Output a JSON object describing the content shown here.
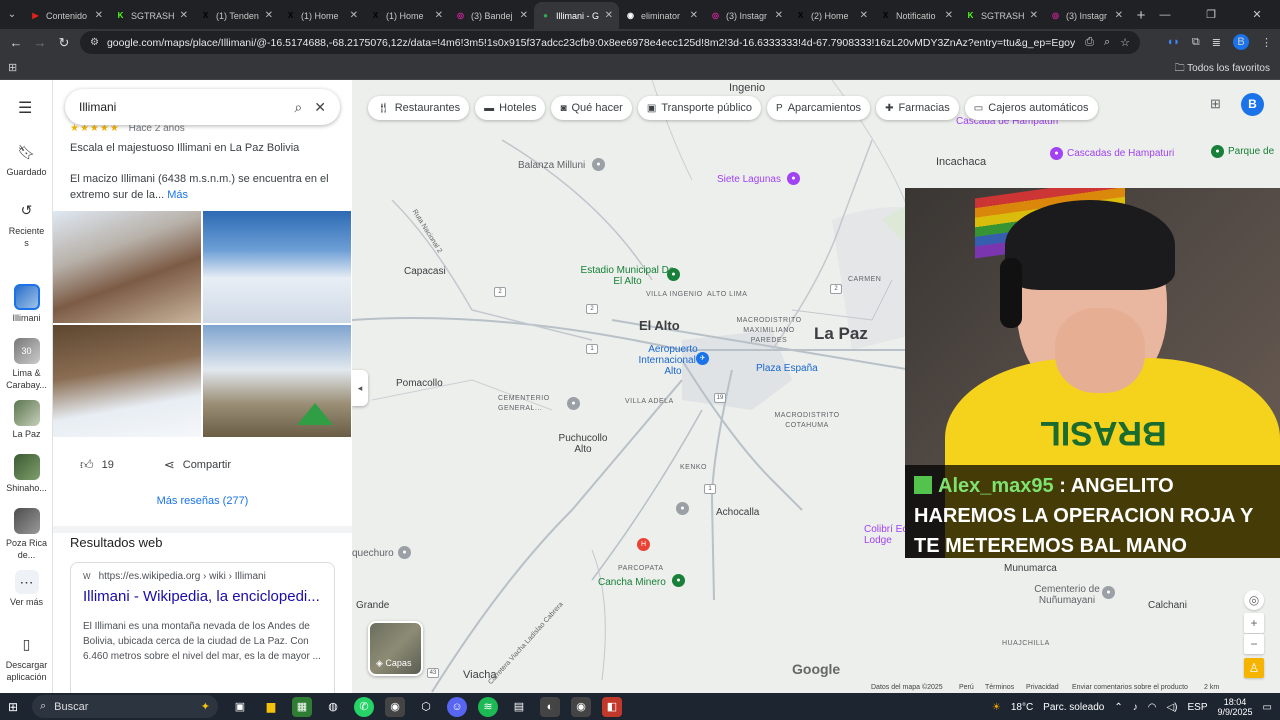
{
  "browser": {
    "tabs": [
      {
        "title": "Contenido",
        "favicon_color": "#e62117",
        "glyph": "▶"
      },
      {
        "title": "SGTRASH",
        "favicon_color": "#53fc18",
        "glyph": "K"
      },
      {
        "title": "(1) Tenden",
        "favicon_color": "#000000",
        "glyph": "X"
      },
      {
        "title": "(1) Home",
        "favicon_color": "#000000",
        "glyph": "X"
      },
      {
        "title": "(1) Home",
        "favicon_color": "#000000",
        "glyph": "X"
      },
      {
        "title": "(3) Bandej",
        "favicon_color": "#d6249f",
        "glyph": "◎"
      },
      {
        "title": "Illimani - G",
        "favicon_color": "#34a853",
        "glyph": "●",
        "active": true
      },
      {
        "title": "eliminator",
        "favicon_color": "#ffffff",
        "glyph": "◉"
      },
      {
        "title": "(3) Instagr",
        "favicon_color": "#d6249f",
        "glyph": "◎"
      },
      {
        "title": "(2) Home",
        "favicon_color": "#000000",
        "glyph": "X"
      },
      {
        "title": "Notificatio",
        "favicon_color": "#000000",
        "glyph": "X"
      },
      {
        "title": "SGTRASH",
        "favicon_color": "#53fc18",
        "glyph": "K"
      },
      {
        "title": "(3) Instagr",
        "favicon_color": "#d6249f",
        "glyph": "◎"
      }
    ],
    "url": "google.com/maps/place/Illimani/@-16.5174688,-68.2175076,12z/data=!4m6!3m5!1s0x915f37adcc23cfb9:0x8ee6978e4ecc125d!8m2!3d-16.6333333!4d-67.7908333!16zL20vMDY3ZnAz?entry=ttu&g_ep=EgoyMDI1MDkwNy4wIKXMDS...",
    "bookmarks_all": "Todos los favoritos",
    "profile_initial": "B"
  },
  "rail": {
    "items": [
      {
        "label": "Guardado",
        "icon": "bookmark-icon"
      },
      {
        "label": "Reciente s",
        "icon": "history-icon"
      },
      {
        "label": "Illimani",
        "icon": "place-thumb"
      },
      {
        "label": "Lima & Carabay...",
        "icon": "place-thumb",
        "badge": "30"
      },
      {
        "label": "La Paz",
        "icon": "place-thumb"
      },
      {
        "label": "Shinaho...",
        "icon": "place-thumb"
      },
      {
        "label": "Poza Rica de...",
        "icon": "place-thumb"
      },
      {
        "label": "Ver más",
        "icon": "more-icon"
      },
      {
        "label": "Descargar aplicación",
        "icon": "phone-icon"
      }
    ]
  },
  "panel": {
    "search_query": "Illimani",
    "review_stars": "★★★★★",
    "review_date": "Hace 2 años",
    "review_title": "Escala el majestuoso Illimani en La Paz Bolivia",
    "review_body": "El macizo Illimani (6438 m.s.n.m.) se encuentra en el extremo sur de la...",
    "review_more": "Más",
    "likes": "19",
    "share_label": "Compartir",
    "more_reviews": "Más reseñas (277)",
    "web_results_heading": "Resultados web",
    "web_result": {
      "source": "https://es.wikipedia.org › wiki › Illimani",
      "title": "Illimani - Wikipedia, la enciclopedi...",
      "description": "El Illimani es una montaña nevada de los Andes de Bolivia, ubicada cerca de la ciudad de La Paz. Con 6.460 metros sobre el nivel del mar, es la de mayor ..."
    }
  },
  "map": {
    "chips": [
      {
        "label": "Restaurantes",
        "icon": "fork-knife-icon"
      },
      {
        "label": "Hoteles",
        "icon": "bed-icon"
      },
      {
        "label": "Qué hacer",
        "icon": "camera-icon"
      },
      {
        "label": "Transporte público",
        "icon": "train-icon"
      },
      {
        "label": "Aparcamientos",
        "icon": "parking-icon"
      },
      {
        "label": "Farmacias",
        "icon": "pharmacy-icon"
      },
      {
        "label": "Cajeros automáticos",
        "icon": "atm-icon"
      }
    ],
    "labels": {
      "ingenio": "Ingenio",
      "cascada_top": "Cascada de Hampaturi",
      "incachaca": "Incachaca",
      "cascadas": "Cascadas de Hampaturi",
      "parque": "Parque de",
      "balanza": "Balanza Milluni",
      "siete_lagunas": "Siete Lagunas",
      "ruta": "Ruta Nacional 2",
      "capacasi": "Capacasi",
      "estadio": "Estadio Municipal De El Alto",
      "villa_ingenio": "VILLA INGENIO",
      "alto_lima": "ALTO LIMA",
      "carmen": "CARMEN",
      "el_alto": "El Alto",
      "macrodistrito": "MACRODISTRITO MAXIMILIANO PAREDES",
      "la_paz": "La Paz",
      "aeropuerto": "Aeropuerto Internacional El Alto",
      "plaza": "Plaza España",
      "pomacollo": "Pomacollo",
      "cementerio": "CEMENTERIO GENERAL...",
      "villa_adela": "VILLA ADELA",
      "macro_cotahuma": "MACRODISTRITO COTAHUMA",
      "puchucollo": "Puchucollo Alto",
      "kenko": "KENKO",
      "achocalla": "Achocalla",
      "colibri": "Colibrí Eco Lodge",
      "parcopata": "PARCOPATA",
      "cancha": "Cancha Minero",
      "quechuro": "quechuro",
      "grande": "Grande",
      "munumarca": "Munumarca",
      "cementerio_nunu": "Cementerio de Nuñumayani",
      "calchani": "Calchani",
      "huajchilla": "HUAJCHILLA",
      "viacha": "Viacha",
      "carretera": "Carretera Viacha Ladislao Cabrera"
    },
    "layers_label": "Capas",
    "google": "Google",
    "footer": {
      "data": "Datos del mapa ©2025",
      "country": "Perú",
      "terms": "Términos",
      "privacy": "Privacidad",
      "feedback": "Enviar comentarios sobre el producto",
      "scale": "2 km"
    }
  },
  "stream": {
    "shirt_text": "BRASIL",
    "chat_user": "Alex_max95",
    "chat_message": ": ANGELITO HAREMOS LA OPERACION ROJA Y TE METEREMOS BAL MANO"
  },
  "taskbar": {
    "search_placeholder": "Buscar",
    "temperature": "18°C",
    "weather": "Parc. soleado",
    "language": "ESP",
    "time": "18:04",
    "date": "9/9/2025"
  }
}
